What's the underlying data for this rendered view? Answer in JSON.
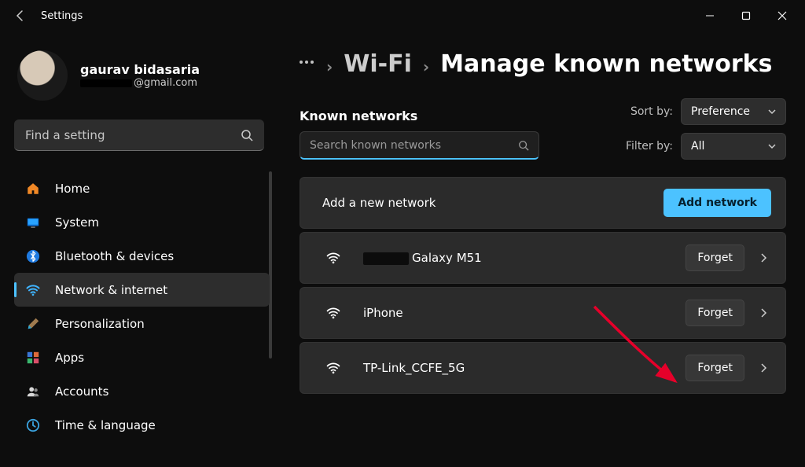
{
  "window": {
    "title": "Settings"
  },
  "user": {
    "name": "gaurav bidasaria",
    "email_suffix": "@gmail.com"
  },
  "sidebar": {
    "search_placeholder": "Find a setting",
    "items": [
      {
        "label": "Home",
        "icon": "home"
      },
      {
        "label": "System",
        "icon": "system"
      },
      {
        "label": "Bluetooth & devices",
        "icon": "bluetooth"
      },
      {
        "label": "Network & internet",
        "icon": "wifi",
        "active": true
      },
      {
        "label": "Personalization",
        "icon": "brush"
      },
      {
        "label": "Apps",
        "icon": "apps"
      },
      {
        "label": "Accounts",
        "icon": "accounts"
      },
      {
        "label": "Time & language",
        "icon": "time"
      }
    ]
  },
  "breadcrumb": {
    "level1": "Wi-Fi",
    "level2": "Manage known networks"
  },
  "known": {
    "heading": "Known networks",
    "search_placeholder": "Search known networks",
    "sort_label": "Sort by:",
    "sort_value": "Preference",
    "filter_label": "Filter by:",
    "filter_value": "All",
    "add_label": "Add a new network",
    "add_button": "Add network",
    "forget_button": "Forget",
    "networks": [
      {
        "name_suffix": "Galaxy M51",
        "redacted_prefix": true
      },
      {
        "name": "iPhone"
      },
      {
        "name": "TP-Link_CCFE_5G"
      }
    ]
  }
}
